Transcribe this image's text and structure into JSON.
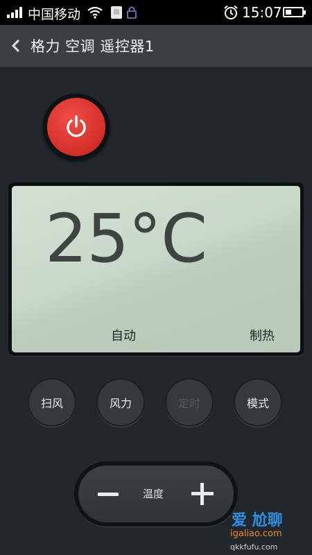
{
  "status_bar": {
    "carrier": "中国移动",
    "time": "15:07",
    "battery_level": 0.35
  },
  "header": {
    "back_icon": "chevron-left-icon",
    "title": "格力 空调 遥控器1"
  },
  "power": {
    "icon": "power-icon",
    "color": "#d8332c"
  },
  "display": {
    "temperature": "25°C",
    "fan_mode": "自动",
    "operating_mode": "制热"
  },
  "buttons": [
    {
      "label": "扫风",
      "enabled": true
    },
    {
      "label": "风力",
      "enabled": true
    },
    {
      "label": "定时",
      "enabled": false
    },
    {
      "label": "模式",
      "enabled": true
    }
  ],
  "temperature_control": {
    "label": "温度",
    "decrease_icon": "minus-icon",
    "increase_icon": "plus-icon"
  },
  "watermark": {
    "line1": "爱 尬聊",
    "line2": "igaliao.com",
    "line3": "qkkfufu.com"
  }
}
